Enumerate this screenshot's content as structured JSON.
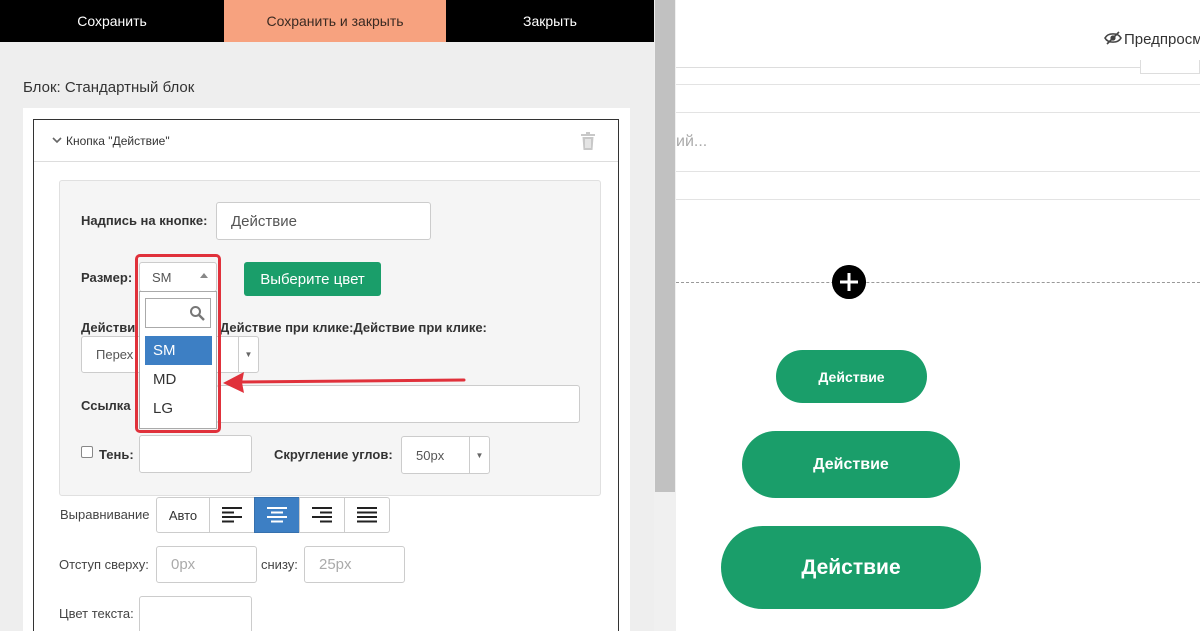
{
  "toolbar": {
    "save_label": "Сохранить",
    "save_close_label": "Сохранить и закрыть",
    "close_label": "Закрыть"
  },
  "block_title": "Блок: Стандартный блок",
  "card": {
    "title": "Кнопка \"Действие\""
  },
  "form": {
    "caption_label": "Надпись на кнопке:",
    "caption_value": "Действие",
    "size_label": "Размер:",
    "size_value": "SM",
    "size_options": [
      "SM",
      "MD",
      "LG"
    ],
    "color_button_label": "Выберите цвет",
    "action_label_partial": "Действи",
    "action_label_repeat": "Действие при клике:Действие при клике:",
    "action_value_partial": "Перех",
    "link_label_partial": "Ссылка",
    "shadow_label": "Тень:",
    "radius_label": "Скругление углов:",
    "radius_value": "50px",
    "align_label": "Выравнивание",
    "align_auto_label": "Авто",
    "margin_top_label": "Отступ сверху:",
    "margin_top_placeholder": "0px",
    "margin_bottom_label": "снизу:",
    "margin_bottom_placeholder": "25px",
    "text_color_label": "Цвет текста:"
  },
  "preview": {
    "preview_label": "Предпросм",
    "ghost_text": "ий...",
    "button_small": "Действие",
    "button_medium": "Действие",
    "button_large": "Действие"
  },
  "colors": {
    "accent_green": "#1a9e6a",
    "save_close_bg": "#f7a27f",
    "selected_blue": "#3d7fc4",
    "highlight_red": "#e0313b"
  },
  "icons": [
    "chevron-down-icon",
    "trash-icon",
    "search-icon",
    "align-left-icon",
    "align-center-icon",
    "align-right-icon",
    "align-justify-icon",
    "eye-icon",
    "plus-circle-icon"
  ]
}
